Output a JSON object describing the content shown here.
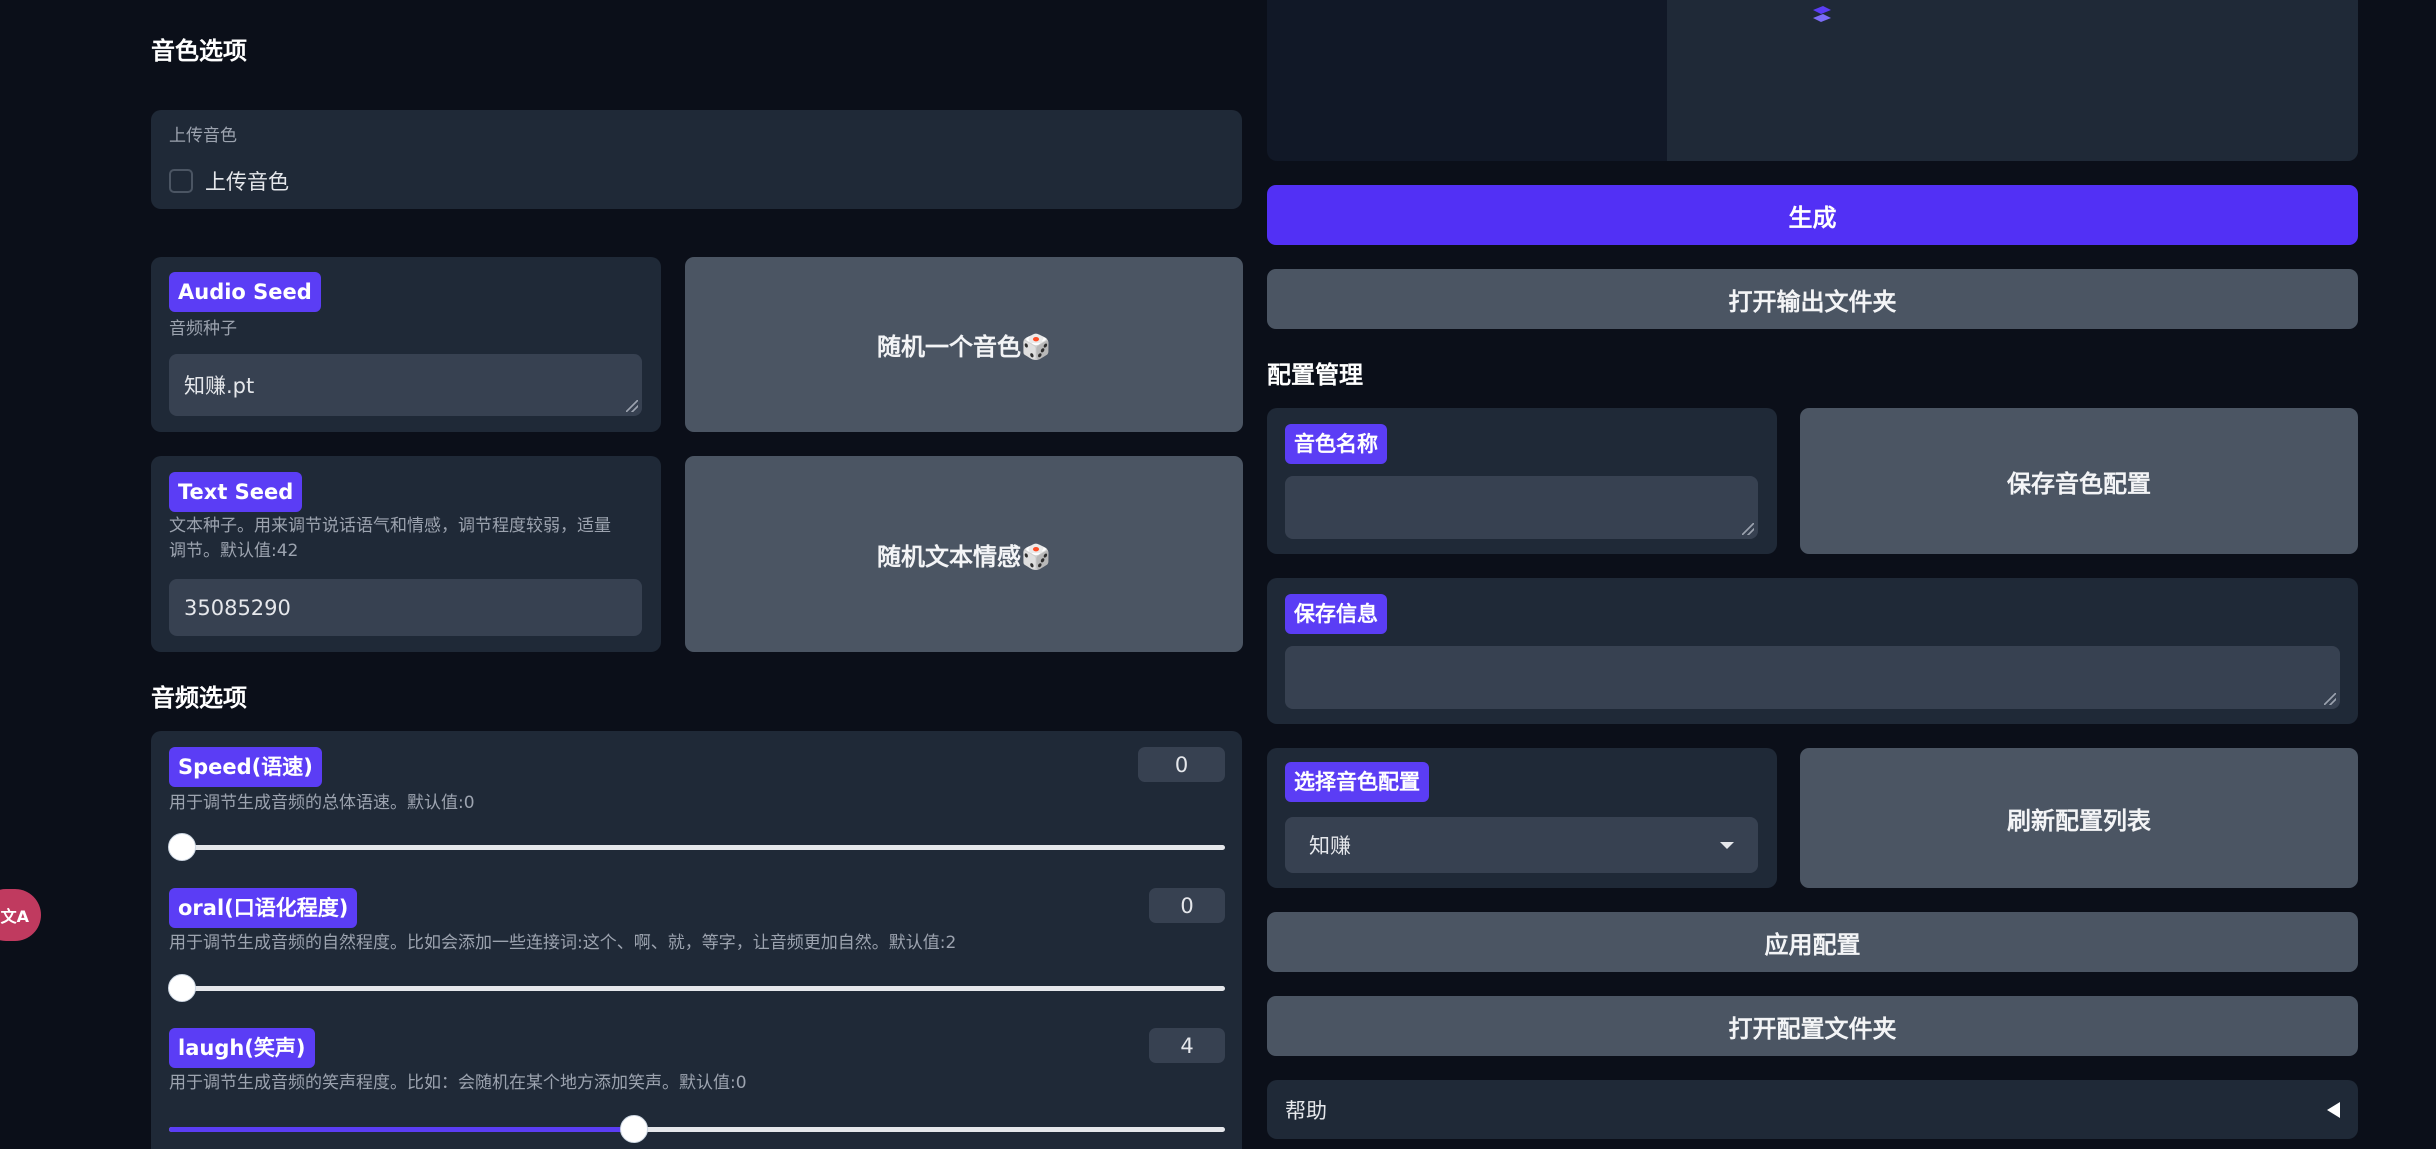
{
  "voice_options": {
    "title": "音色选项",
    "upload": {
      "panel_label": "上传音色",
      "checkbox_label": "上传音色"
    },
    "audio_seed": {
      "label": "Audio Seed",
      "info": "音频种子",
      "value": "知赚.pt"
    },
    "random_voice_button": "随机一个音色🎲",
    "text_seed": {
      "label": "Text Seed",
      "info_line1": "文本种子。用来调节说话语气和情感，调节程度较弱，适量",
      "info_line2": "调节。默认值:42",
      "value": "35085290"
    },
    "random_emotion_button": "随机文本情感🎲"
  },
  "audio_options": {
    "title": "音频选项",
    "sliders": [
      {
        "label": "Speed(语速)",
        "info": "用于调节生成音频的总体语速。默认值:0",
        "value": "0",
        "fraction": 0.0
      },
      {
        "label": "oral(口语化程度)",
        "info": "用于调节生成音频的自然程度。比如会添加一些连接词:这个、啊、就，等字，让音频更加自然。默认值:2",
        "value": "0",
        "fraction": 0.0
      },
      {
        "label": "laugh(笑声)",
        "info": "用于调节生成音频的笑声程度。比如：会随机在某个地方添加笑声。默认值:0",
        "value": "4",
        "fraction": 0.44
      }
    ]
  },
  "output": {
    "generate_button": "生成",
    "open_output_folder_button": "打开输出文件夹",
    "spinner_icon": "loading-icon"
  },
  "config_management": {
    "title": "配置管理",
    "voice_name": {
      "label": "音色名称",
      "value": ""
    },
    "save_voice_config_button": "保存音色配置",
    "save_info": {
      "label": "保存信息",
      "value": ""
    },
    "select_config": {
      "label": "选择音色配置",
      "selected": "知赚"
    },
    "refresh_list_button": "刷新配置列表",
    "apply_config_button": "应用配置",
    "open_config_folder_button": "打开配置文件夹",
    "help": {
      "label": "帮助",
      "toggle_icon": "triangle-left-icon"
    }
  },
  "floating": {
    "translate_icon": "translate-icon"
  },
  "colors": {
    "accent": "#5230f5",
    "badge": "#5b3df5",
    "panel": "#1f2937",
    "background": "#0b0f19"
  }
}
